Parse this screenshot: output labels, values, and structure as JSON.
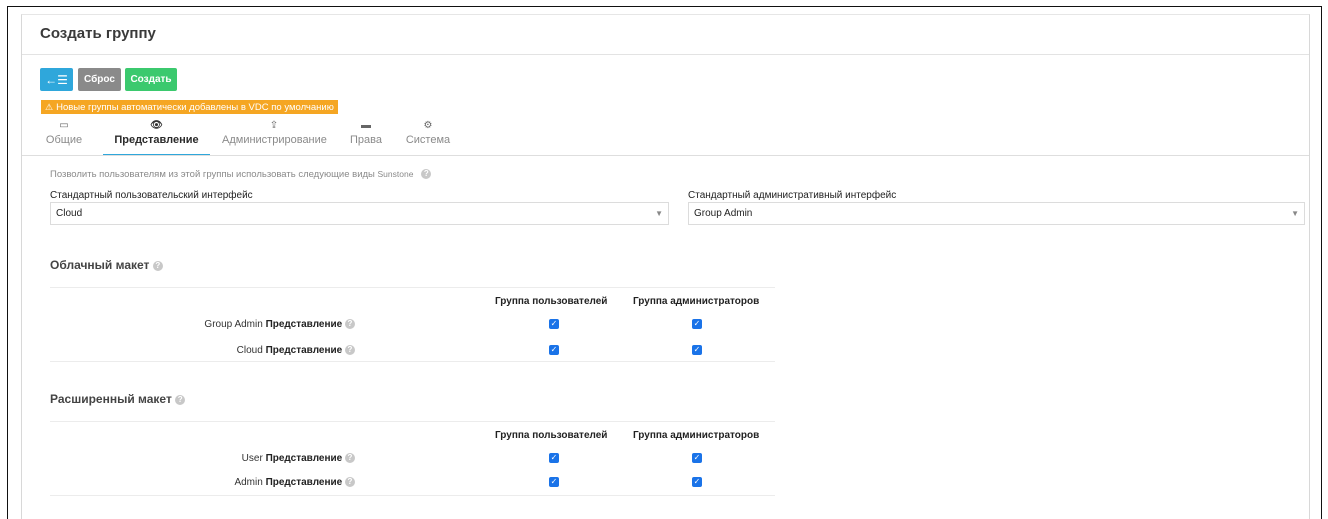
{
  "page_title": "Создать группу",
  "toolbar": {
    "back_icon": "←☰",
    "reset_label": "Сброс",
    "create_label": "Создать"
  },
  "warning": {
    "icon": "⚠",
    "text": "Новые группы автоматически добавлены в VDC по умолчанию",
    "color": "#f5a623"
  },
  "tabs": [
    {
      "label": "Общие",
      "icon": "monitor-icon",
      "glyph": "▭"
    },
    {
      "label": "Представление",
      "icon": "eye-icon",
      "glyph": "👁"
    },
    {
      "label": "Администрирование",
      "icon": "upload-icon",
      "glyph": "⇪"
    },
    {
      "label": "Права",
      "icon": "folder-icon",
      "glyph": "▬"
    },
    {
      "label": "Система",
      "icon": "gear-icon",
      "glyph": "⚙"
    }
  ],
  "active_tab": "Представление",
  "views_section": {
    "description": "Позволить пользователям из этой группы использовать следующие виды",
    "description_suffix": "Sunstone",
    "help_icon": "?",
    "default_user_label": "Стандартный пользовательский интерфейс",
    "default_user_value": "Cloud",
    "default_admin_label": "Стандартный административный интерфейс",
    "default_admin_value": "Group Admin"
  },
  "cloud_layout": {
    "heading": "Облачный макет",
    "col_users": "Группа пользователей",
    "col_admins": "Группа администраторов",
    "rows": [
      {
        "name": "Group Admin",
        "suffix": "Представление",
        "users": true,
        "admins": true
      },
      {
        "name": "Cloud",
        "suffix": "Представление",
        "users": true,
        "admins": true
      }
    ]
  },
  "advanced_layout": {
    "heading": "Расширенный макет",
    "col_users": "Группа пользователей",
    "col_admins": "Группа администраторов",
    "rows": [
      {
        "name": "User",
        "suffix": "Представление",
        "users": true,
        "admins": true
      },
      {
        "name": "Admin",
        "suffix": "Представление",
        "users": true,
        "admins": true
      }
    ]
  },
  "colors": {
    "accent": "#2fa7db",
    "reset": "#8a8a8a",
    "create": "#3bc96e",
    "checkbox": "#1a73e8"
  }
}
